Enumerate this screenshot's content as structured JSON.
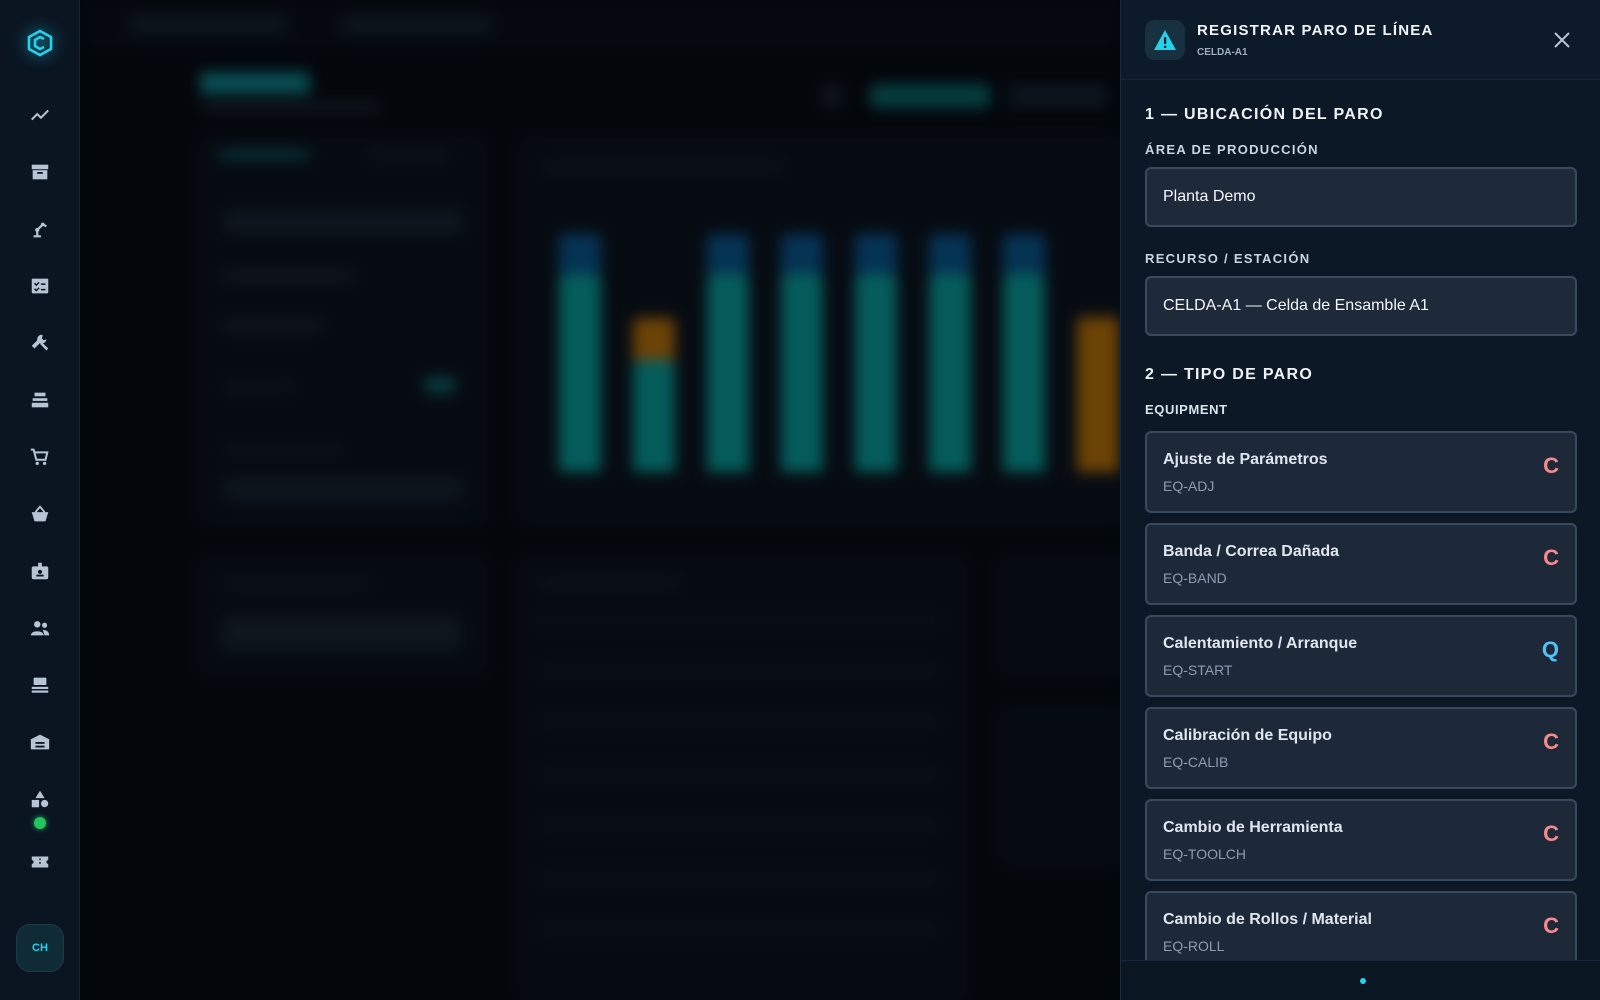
{
  "app": {
    "avatar_initials": "CH"
  },
  "nav": {
    "items": [
      "trend-chart-icon",
      "archive-box-icon",
      "robot-arm-icon",
      "checklist-icon",
      "wrench-icon",
      "machine-icon",
      "cart-icon",
      "basket-icon",
      "id-badge-icon",
      "users-icon",
      "workstation-icon",
      "warehouse-icon",
      "shapes-icon",
      "ticket-icon"
    ],
    "status_color": "#22c55e"
  },
  "modal": {
    "title": "REGISTRAR PARO DE LÍNEA",
    "subtitle": "CELDA-A1",
    "section1": {
      "title": "1 — UBICACIÓN DEL PARO",
      "area_label": "ÁREA DE PRODUCCIÓN",
      "area_value": "Planta Demo",
      "resource_label": "RECURSO / ESTACIÓN",
      "resource_value": "CELDA-A1 — Celda de Ensamble A1"
    },
    "section2": {
      "title": "2 — TIPO DE PARO",
      "group_label": "EQUIPMENT",
      "options": [
        {
          "name": "Ajuste de Parámetros",
          "code": "EQ-ADJ",
          "tag": "C"
        },
        {
          "name": "Banda / Correa Dañada",
          "code": "EQ-BAND",
          "tag": "C"
        },
        {
          "name": "Calentamiento / Arranque",
          "code": "EQ-START",
          "tag": "Q"
        },
        {
          "name": "Calibración de Equipo",
          "code": "EQ-CALIB",
          "tag": "C"
        },
        {
          "name": "Cambio de Herramienta",
          "code": "EQ-TOOLCH",
          "tag": "C"
        },
        {
          "name": "Cambio de Rollos / Material",
          "code": "EQ-ROLL",
          "tag": "C"
        }
      ]
    }
  },
  "colors": {
    "accent": "#22d3ee",
    "tag_c": "#f38b8b",
    "tag_q": "#4fc3f7",
    "warning": "#22d3ee"
  }
}
